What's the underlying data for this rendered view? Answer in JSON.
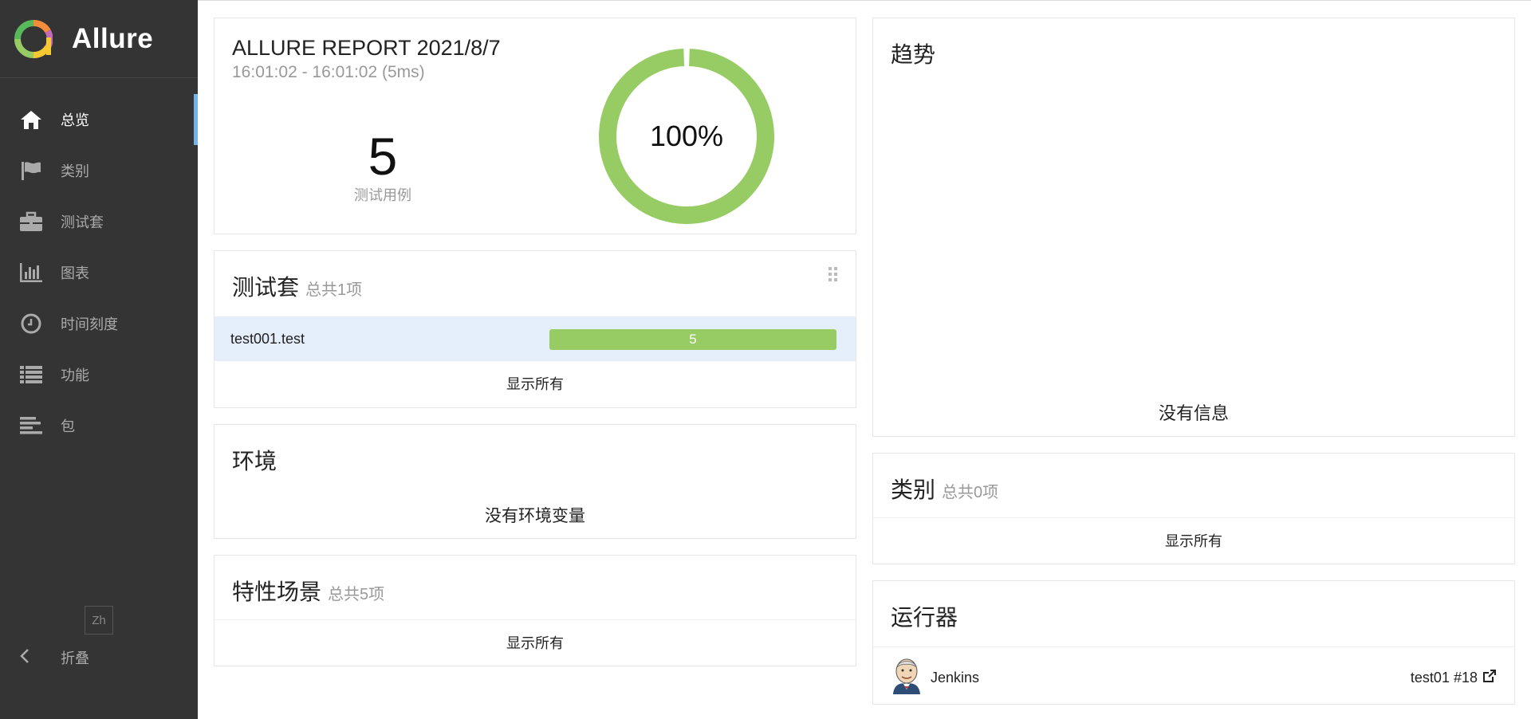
{
  "brand": {
    "name": "Allure"
  },
  "sidebar": {
    "items": [
      {
        "label": "总览",
        "icon": "home-icon",
        "active": true
      },
      {
        "label": "类别",
        "icon": "flag-icon"
      },
      {
        "label": "测试套",
        "icon": "briefcase-icon"
      },
      {
        "label": "图表",
        "icon": "bar-chart-icon"
      },
      {
        "label": "时间刻度",
        "icon": "clock-icon"
      },
      {
        "label": "功能",
        "icon": "list-icon"
      },
      {
        "label": "包",
        "icon": "align-left-icon"
      }
    ],
    "lang": "Zh",
    "collapse": "折叠"
  },
  "summary": {
    "title": "ALLURE REPORT 2021/8/7",
    "time": "16:01:02 - 16:01:02 (5ms)",
    "count": "5",
    "count_label": "测试用例",
    "percent": "100%",
    "passed_fraction": 1.0
  },
  "suites": {
    "title": "测试套",
    "subtitle": "总共1项",
    "rows": [
      {
        "name": "test001.test",
        "count": "5"
      }
    ],
    "show_all": "显示所有"
  },
  "environment": {
    "title": "环境",
    "empty": "没有环境变量"
  },
  "features": {
    "title": "特性场景",
    "subtitle": "总共5项",
    "show_all": "显示所有"
  },
  "trend": {
    "title": "趋势",
    "empty": "没有信息"
  },
  "categories": {
    "title": "类别",
    "subtitle": "总共0项",
    "show_all": "显示所有"
  },
  "executors": {
    "title": "运行器",
    "name": "Jenkins",
    "build": "test01 #18"
  },
  "colors": {
    "passed": "#97cc64",
    "sidebar_bg": "#343434",
    "active_bar": "#74b3e8",
    "row_highlight": "#e5eefb"
  }
}
